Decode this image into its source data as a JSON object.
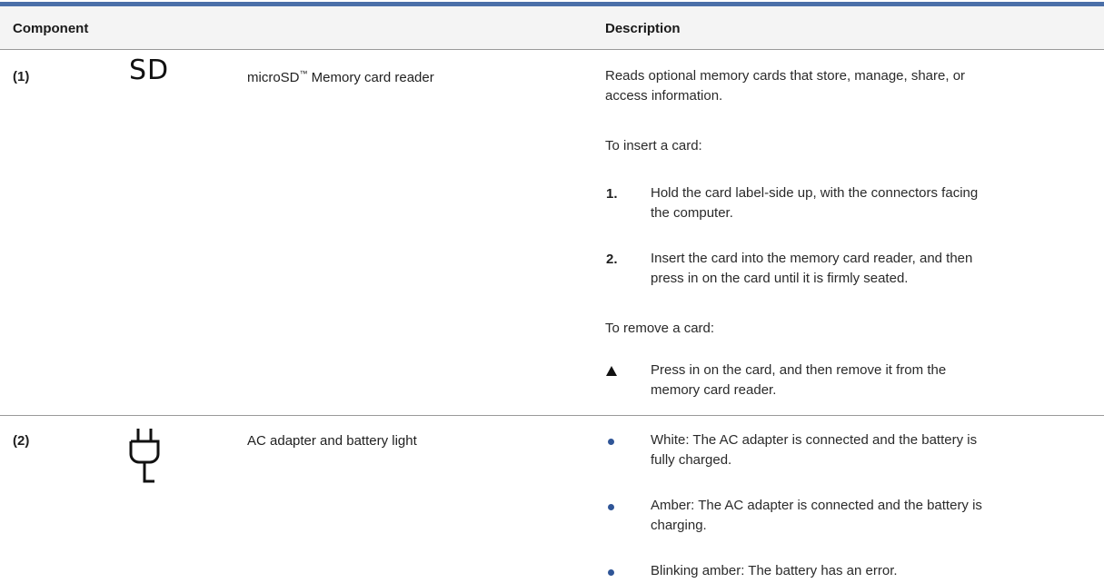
{
  "header": {
    "col_component": "Component",
    "col_description": "Description"
  },
  "rows": [
    {
      "number": "(1)",
      "icon": "SD",
      "icon_name": "sd-card-icon",
      "name_prefix": "microSD",
      "name_tm": "™",
      "name_suffix": " Memory card reader",
      "desc_line1": "Reads optional memory cards that store, manage, share, or",
      "desc_line2": "access information.",
      "insert_heading": "To insert a card:",
      "steps": [
        {
          "marker": "1.",
          "line1": "Hold the card label-side up, with the connectors facing",
          "line2": "the computer."
        },
        {
          "marker": "2.",
          "line1": "Insert the card into the memory card reader, and then",
          "line2": "press in on the card until it is firmly seated."
        }
      ],
      "remove_heading": "To remove a card:",
      "remove_step": {
        "line1": "Press in on the card, and then remove it from the",
        "line2": "memory card reader."
      }
    },
    {
      "number": "(2)",
      "icon_name": "ac-plug-icon",
      "name": "AC adapter and battery light",
      "bullets": [
        {
          "line1": "White: The AC adapter is connected and the battery is",
          "line2": "fully charged."
        },
        {
          "line1": "Amber: The AC adapter is connected and the battery is",
          "line2": "charging."
        },
        {
          "line1": "Blinking amber: The battery has an error.",
          "line2": ""
        }
      ]
    }
  ],
  "colors": {
    "rule": "#4a6fa8",
    "bullet": "#2f5597",
    "header_bg": "#f4f4f4"
  }
}
